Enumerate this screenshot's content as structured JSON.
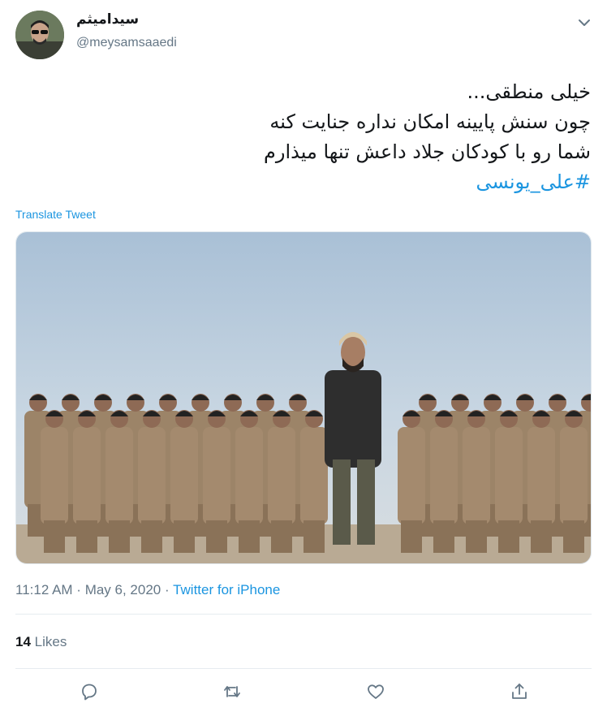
{
  "user": {
    "display_name": "سیدامیثم",
    "handle": "@meysamsaaedi"
  },
  "tweet": {
    "lines": [
      "خیلی منطقی...",
      "چون سنش پایینه امکان نداره جنایت کنه",
      "شما رو با کودکان جلاد داعش تنها میذارم"
    ],
    "hashtag": "#علی_یونسی",
    "translate_label": "Translate Tweet"
  },
  "meta": {
    "time": "11:12 AM",
    "separator1": " · ",
    "date": "May 6, 2020",
    "separator2": " · ",
    "source": "Twitter for iPhone"
  },
  "stats": {
    "likes_count": "14",
    "likes_label": "Likes"
  },
  "icons": {
    "more": "chevron-down-icon",
    "reply": "reply-icon",
    "retweet": "retweet-icon",
    "like": "heart-icon",
    "share": "share-icon"
  },
  "colors": {
    "link": "#1b95e0",
    "secondary": "#657786",
    "divider": "#e6ecf0"
  }
}
